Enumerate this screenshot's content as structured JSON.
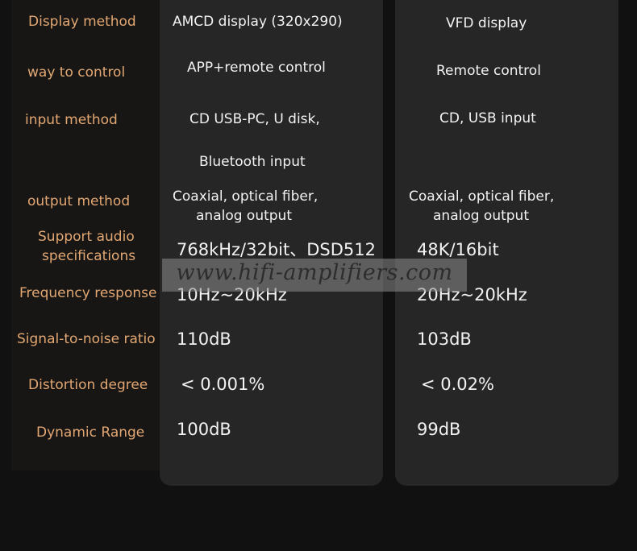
{
  "watermark": "www.hifi-amplifiers.com",
  "colors": {
    "label": "#e2a772",
    "value": "#f2f2f2",
    "card": "#262627",
    "background": "#111111"
  },
  "rows": [
    {
      "label": "Display method",
      "a": "AMCD display (320x290)",
      "b": "VFD display"
    },
    {
      "label": "way to control",
      "a": "APP+remote control",
      "b": "Remote control"
    },
    {
      "label": "input method",
      "a": "CD USB-PC, U disk,",
      "a2": "Bluetooth input",
      "b": "CD, USB input"
    },
    {
      "label": "output method",
      "a": "Coaxial, optical fiber,",
      "a2": "analog output",
      "b": "Coaxial, optical fiber,",
      "b2": "analog output"
    },
    {
      "label": "Support audio",
      "label2": "specifications",
      "a": "768kHz/32bit、DSD512",
      "b": "48K/16bit"
    },
    {
      "label": "Frequency response",
      "a": "10Hz~20kHz",
      "b": "20Hz~20kHz"
    },
    {
      "label": "Signal-to-noise ratio",
      "a": "110dB",
      "b": "103dB"
    },
    {
      "label": "Distortion degree",
      "a": "< 0.001%",
      "b": "< 0.02%"
    },
    {
      "label": "Dynamic Range",
      "a": "100dB",
      "b": "99dB"
    }
  ]
}
